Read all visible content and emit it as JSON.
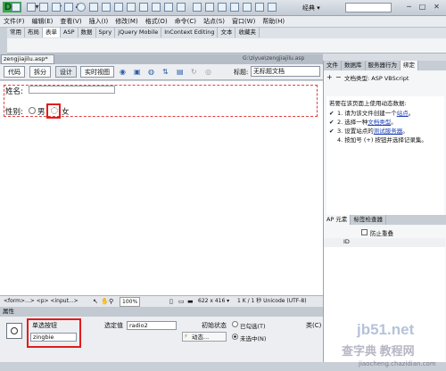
{
  "app": {
    "logo": "Dw",
    "workspace": "经典 ▾"
  },
  "menu": [
    "文件(F)",
    "编辑(E)",
    "查看(V)",
    "插入(I)",
    "修改(M)",
    "格式(O)",
    "命令(C)",
    "站点(S)",
    "窗口(W)",
    "帮助(H)"
  ],
  "insert_tabs": [
    "常用",
    "布局",
    "表单",
    "ASP",
    "数据",
    "Spry",
    "jQuery Mobile",
    "InContext Editing",
    "文本",
    "收藏夹"
  ],
  "insert_active": "表单",
  "document": {
    "tab": "zengjiajilu.asp*",
    "path": "G:\\ziyue\\zengjiajilu.asp",
    "views": [
      "代码",
      "拆分",
      "设计",
      "实时视图"
    ],
    "title_label": "标题:",
    "title_value": "无标题文档"
  },
  "canvas": {
    "name_label": "姓名:",
    "sex_label": "性别:",
    "male": "男",
    "female": "女"
  },
  "statusbar": {
    "tags": "<form>...> <p> <input...>",
    "zoom": "100%",
    "size": "622 x 416 ▾",
    "info": "1 K / 1 秒 Unicode (UTF-8)"
  },
  "properties": {
    "header": "属性",
    "button_label": "单选按钮",
    "button_value": "zingbie",
    "checked_label": "选定值",
    "checked_value": "radio2",
    "init_label": "初始状态",
    "opt_checked": "已勾选(T)",
    "opt_unchecked": "未选中(N)",
    "dynamic": "动态...",
    "class_label": "类(C)"
  },
  "right_panel": {
    "tabs": [
      "文件",
      "数据库",
      "服务器行为",
      "绑定"
    ],
    "active": "绑定",
    "doctype": "文档类型: ASP VBScript",
    "dyn_title": "若要在该页面上使用动态数据:",
    "steps": [
      {
        "check": "✔",
        "pre": "1. 请为该文件创建一个",
        "link": "站点",
        "post": "。"
      },
      {
        "check": "✔",
        "pre": "2. 选择一种",
        "link": "文档类型",
        "post": "。"
      },
      {
        "check": "✔",
        "pre": "3. 设置站点的",
        "link": "测试服务器",
        "post": "。"
      },
      {
        "check": "",
        "pre": "4. 按加号 (+) 按钮并选择记录集。",
        "link": "",
        "post": ""
      }
    ],
    "ap_tabs": [
      "AP 元素",
      "标签检查器"
    ],
    "overlap": "防止重叠",
    "ap_header": "ID"
  },
  "watermark": {
    "line1": "jb51.net",
    "line2": "查字典 教程网",
    "line3": "jiaocheng.chazidian.com"
  }
}
